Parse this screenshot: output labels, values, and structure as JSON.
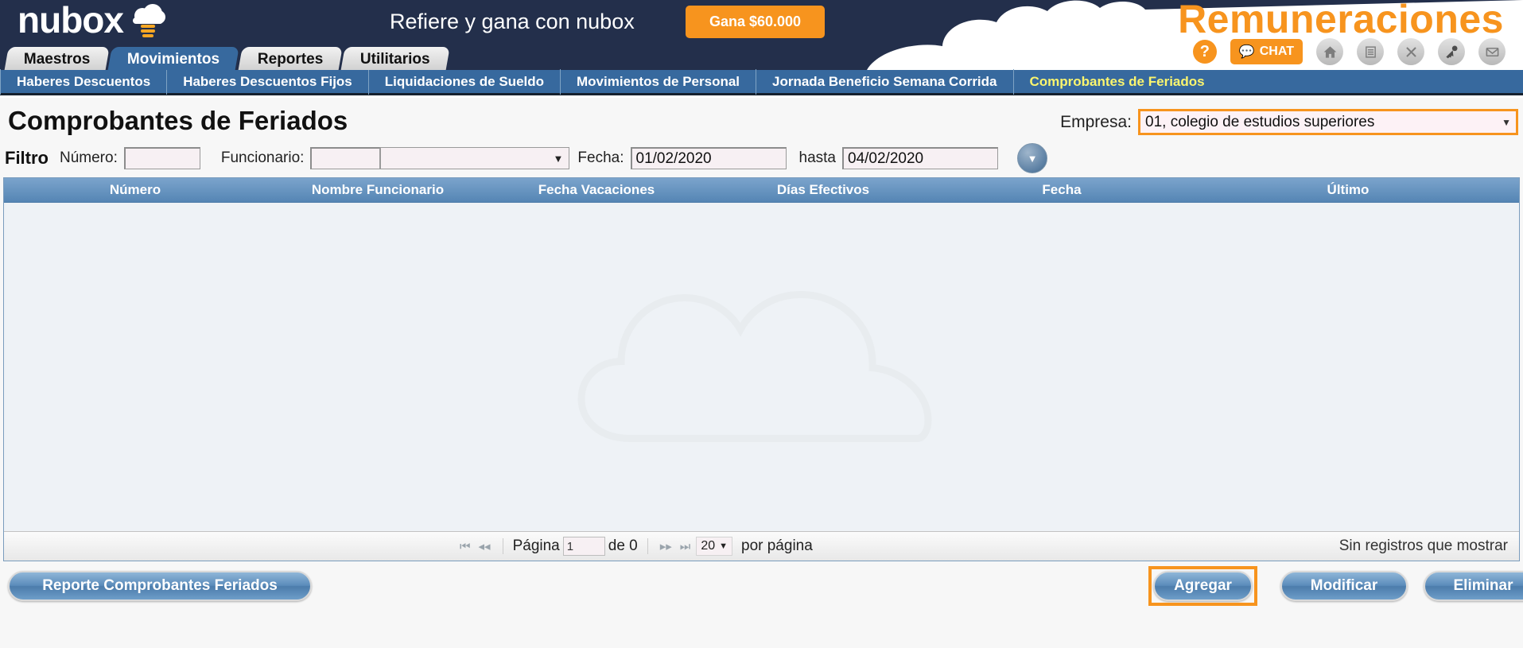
{
  "header": {
    "logo_text": "nubox",
    "logo_icon": "cloud-bars-icon",
    "refer_text": "Refiere y gana con nubox",
    "promo_button": "Gana $60.000",
    "app_title": "Remuneraciones",
    "help_icon": "question-mark-icon",
    "chat_label": "CHAT",
    "chat_icon": "chat-bubble-icon",
    "icons": [
      {
        "name": "home-icon",
        "glyph": "⌂"
      },
      {
        "name": "document-icon",
        "glyph": "▤"
      },
      {
        "name": "close-icon",
        "glyph": "✕"
      },
      {
        "name": "key-icon",
        "glyph": "⚷"
      },
      {
        "name": "mail-icon",
        "glyph": "✉"
      }
    ]
  },
  "tabs": [
    {
      "label": "Maestros",
      "active": false
    },
    {
      "label": "Movimientos",
      "active": true
    },
    {
      "label": "Reportes",
      "active": false
    },
    {
      "label": "Utilitarios",
      "active": false
    }
  ],
  "subnav": [
    {
      "label": "Haberes Descuentos",
      "active": false
    },
    {
      "label": "Haberes Descuentos Fijos",
      "active": false
    },
    {
      "label": "Liquidaciones de Sueldo",
      "active": false
    },
    {
      "label": "Movimientos de Personal",
      "active": false
    },
    {
      "label": "Jornada Beneficio Semana Corrida",
      "active": false
    },
    {
      "label": "Comprobantes de Feriados",
      "active": true
    }
  ],
  "page": {
    "title": "Comprobantes de Feriados",
    "empresa_label": "Empresa:",
    "empresa_value": "01, colegio de estudios superiores",
    "empresa_caret": "▼"
  },
  "filter": {
    "title": "Filtro",
    "numero_label": "Número:",
    "numero_value": "",
    "funcionario_label": "Funcionario:",
    "funcionario_value": "",
    "funcionario_select_value": "",
    "select_caret": "▼",
    "fecha_label": "Fecha:",
    "fecha_desde": "01/02/2020",
    "hasta_label": "hasta",
    "fecha_hasta": "04/02/2020",
    "go_icon": "filter-dropdown-icon",
    "go_glyph": "▼"
  },
  "grid": {
    "columns": [
      "Número",
      "Nombre Funcionario",
      "Fecha Vacaciones",
      "Días Efectivos",
      "Fecha",
      "Último"
    ],
    "rows": [],
    "watermark_icon": "cloud-watermark"
  },
  "pager": {
    "first_icon": "⏮",
    "prev_icon": "⏴⏴",
    "page_label": "Página",
    "page_value": "1",
    "of_label": "de 0",
    "next_icon": "⏵⏵",
    "last_icon": "⏭",
    "page_size": "20",
    "page_size_caret": "▼",
    "per_page_label": "por página",
    "status": "Sin registros que mostrar"
  },
  "buttons": {
    "reporte": "Reporte Comprobantes Feriados",
    "agregar": "Agregar",
    "modificar": "Modificar",
    "eliminar": "Eliminar"
  },
  "colors": {
    "header_bg": "#232f4b",
    "accent_orange": "#f7941e",
    "nav_blue": "#37699e",
    "active_link": "#fbf56e",
    "button_blue": "#5b8cbb"
  }
}
